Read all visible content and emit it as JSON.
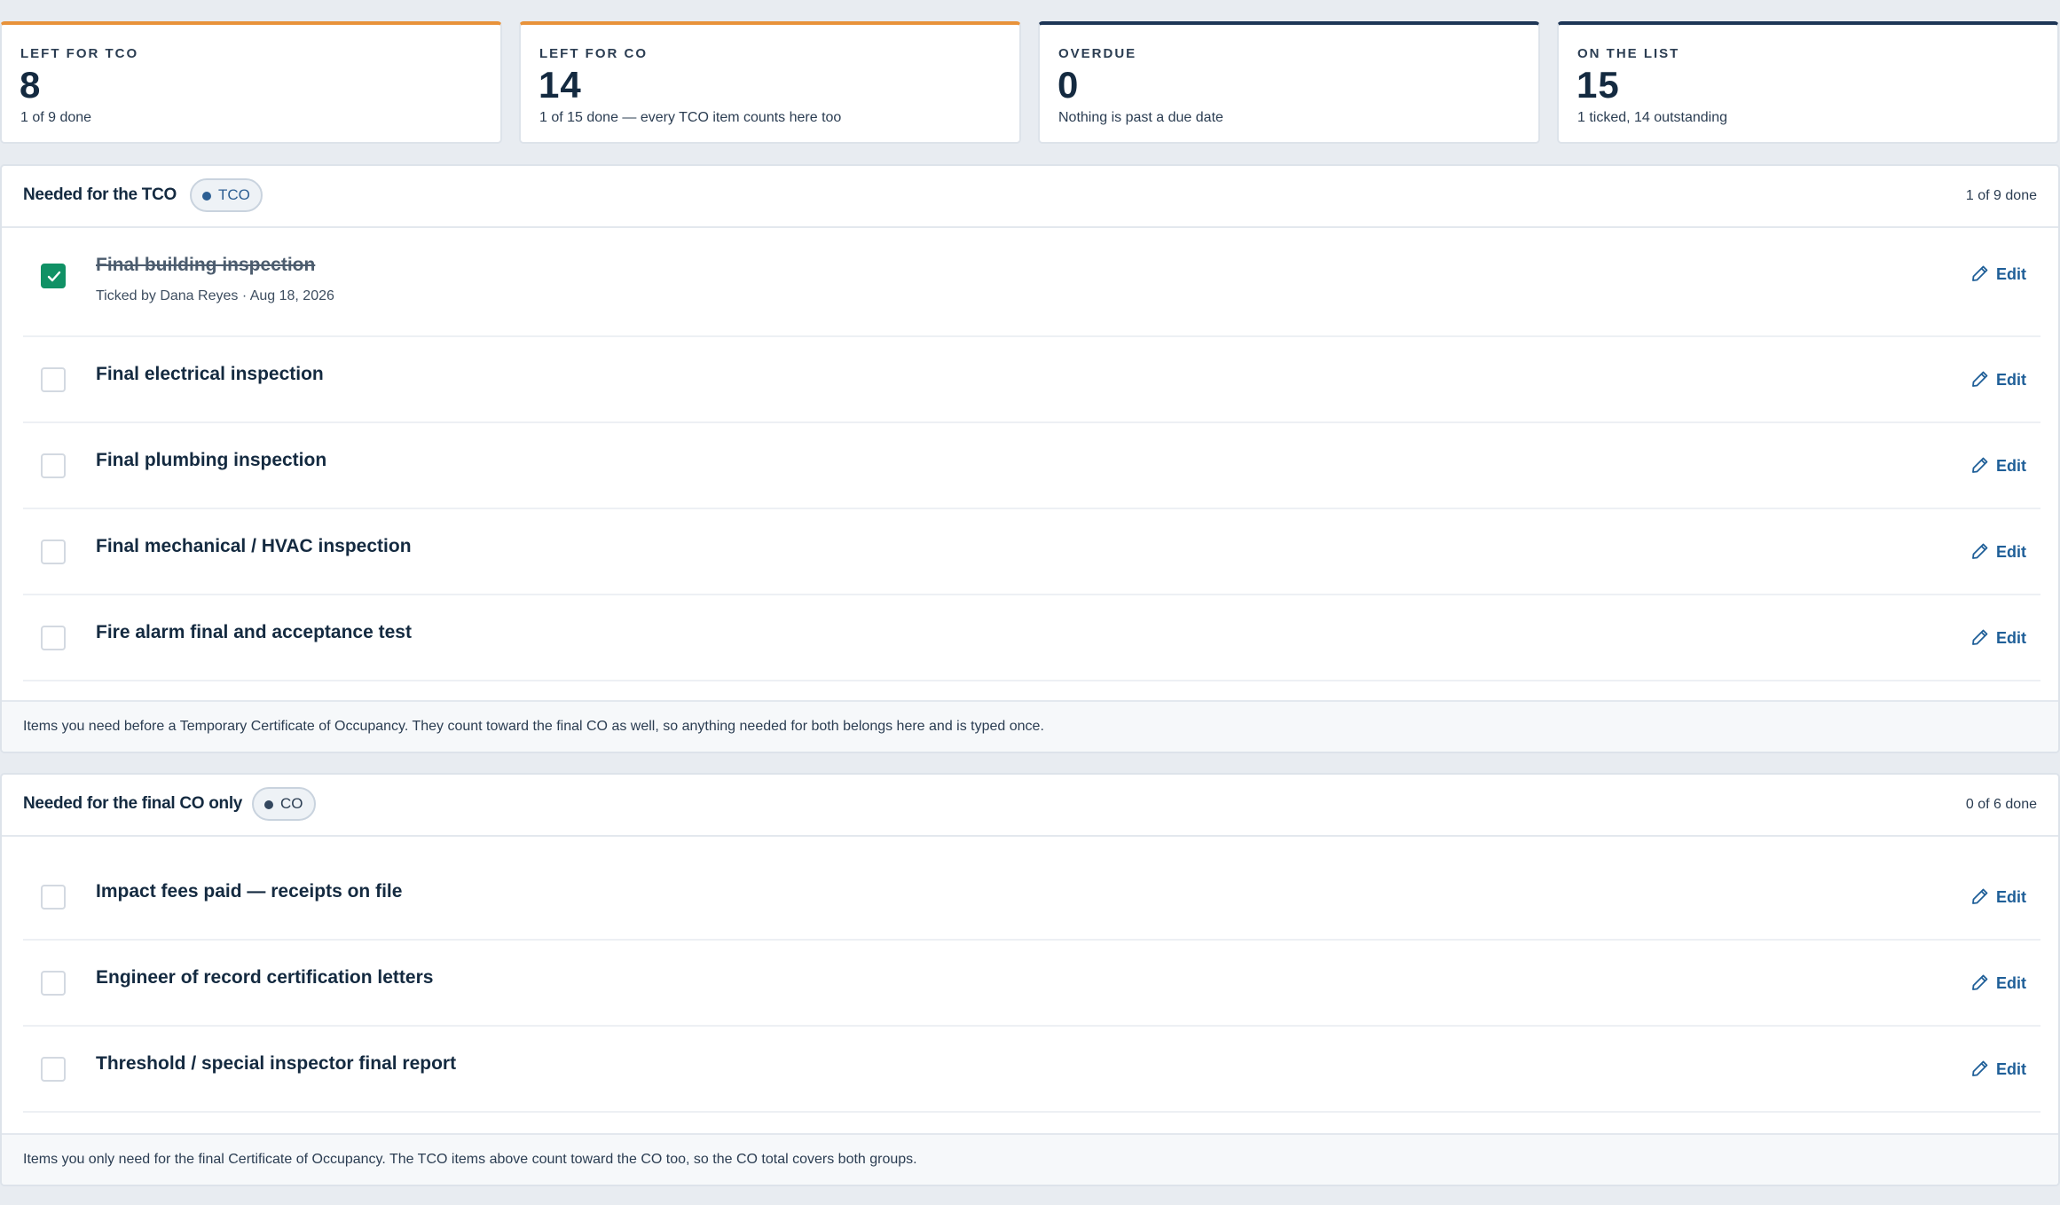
{
  "stats": [
    {
      "label": "LEFT FOR TCO",
      "value": "8",
      "sub": "1 of 9 done",
      "accent": "#e8923a"
    },
    {
      "label": "LEFT FOR CO",
      "value": "14",
      "sub": "1 of 15 done — every TCO item counts here too",
      "accent": "#e8923a"
    },
    {
      "label": "OVERDUE",
      "value": "0",
      "sub": "Nothing is past a due date",
      "accent": "#1e3656"
    },
    {
      "label": "ON THE LIST",
      "value": "15",
      "sub": "1 ticked, 14 outstanding",
      "accent": "#1e3656"
    }
  ],
  "tco_group": {
    "title": "Needed for the TCO",
    "badge": "TCO",
    "progress": "1 of 9 done",
    "items": [
      {
        "title": "Final building inspection",
        "checked": true,
        "meta": "Ticked by Dana Reyes · Aug 18, 2026",
        "edit": "Edit"
      },
      {
        "title": "Final electrical inspection",
        "checked": false,
        "edit": "Edit"
      },
      {
        "title": "Final plumbing inspection",
        "checked": false,
        "edit": "Edit"
      },
      {
        "title": "Final mechanical / HVAC inspection",
        "checked": false,
        "edit": "Edit"
      },
      {
        "title": "Fire alarm final and acceptance test",
        "checked": false,
        "edit": "Edit"
      }
    ],
    "footer": "Items you need before a Temporary Certificate of Occupancy. They count toward the final CO as well, so anything needed for both belongs here and is typed once."
  },
  "co_group": {
    "title": "Needed for the final CO only",
    "badge": "CO",
    "progress": "0 of 6 done",
    "items": [
      {
        "title": "Impact fees paid — receipts on file",
        "checked": false,
        "edit": "Edit"
      },
      {
        "title": "Engineer of record certification letters",
        "checked": false,
        "edit": "Edit"
      },
      {
        "title": "Threshold / special inspector final report",
        "checked": false,
        "edit": "Edit"
      }
    ],
    "footer": "Items you only need for the final Certificate of Occupancy. The TCO items above count toward the CO too, so the CO total covers both groups."
  },
  "colors": {
    "checked": "#109165",
    "edit_link": "#1f5f98",
    "tco_accent": "#e8923a",
    "navy_accent": "#1e3656"
  },
  "icons": {
    "edit": "pencil-icon",
    "checked": "checkmark-icon",
    "badge_dot": "dot-icon"
  }
}
